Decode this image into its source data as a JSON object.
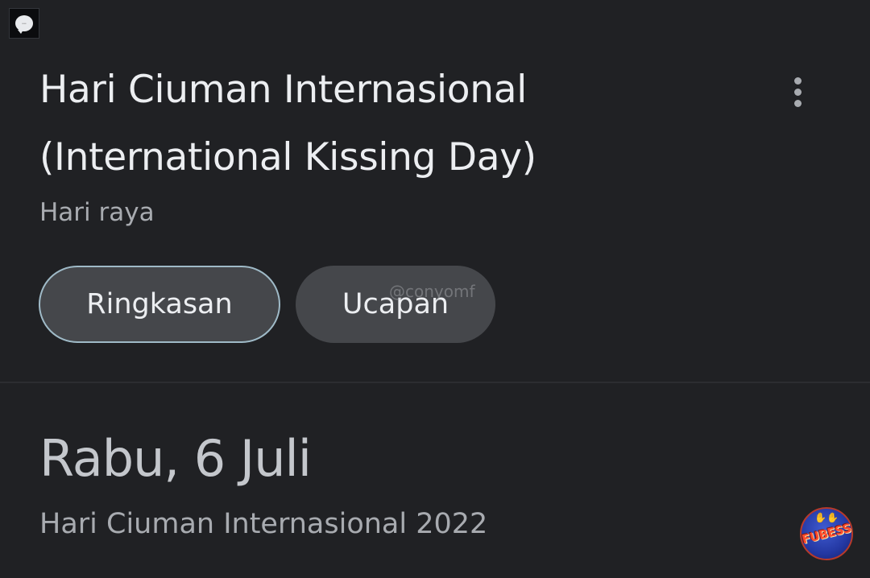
{
  "header": {
    "title_line1": "Hari Ciuman Internasional",
    "title_line2": "(International Kissing Day)",
    "category": "Hari raya"
  },
  "menu": {
    "icon": "more-vert-icon"
  },
  "tabs": [
    {
      "label": "Ringkasan",
      "selected": true
    },
    {
      "label": "Ucapan",
      "selected": false
    }
  ],
  "watermark": {
    "text": "@conyomf"
  },
  "event": {
    "date": "Rabu, 6 Juli",
    "name": "Hari Ciuman Internasional 2022"
  },
  "logo": {
    "text": "FUBESS"
  },
  "colors": {
    "background": "#202124",
    "chip": "#45474b",
    "chip_selected_border": "#9fbac7",
    "text_primary": "#eceef1",
    "text_secondary": "#a8abb0"
  }
}
